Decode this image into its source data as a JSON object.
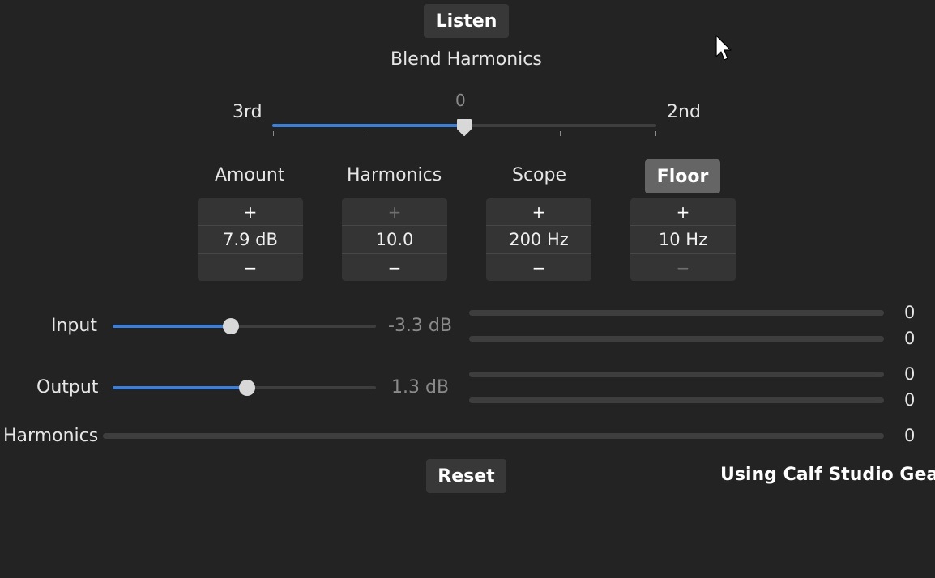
{
  "listen_button": "Listen",
  "blend": {
    "title": "Blend Harmonics",
    "left_label": "3rd",
    "right_label": "2nd",
    "value": "0",
    "position": 0.5
  },
  "spins": [
    {
      "label": "Amount",
      "value": "7.9 dB",
      "plus": "+",
      "minus": "−",
      "plus_enabled": true,
      "minus_enabled": true
    },
    {
      "label": "Harmonics",
      "value": "10.0",
      "plus": "+",
      "minus": "−",
      "plus_enabled": false,
      "minus_enabled": true
    },
    {
      "label": "Scope",
      "value": "200 Hz",
      "plus": "+",
      "minus": "−",
      "plus_enabled": true,
      "minus_enabled": true
    },
    {
      "label": "Floor",
      "value": "10 Hz",
      "plus": "+",
      "minus": "−",
      "plus_enabled": true,
      "minus_enabled": false
    }
  ],
  "input": {
    "label": "Input",
    "value": "-3.3 dB",
    "level": 0.45
  },
  "output": {
    "label": "Output",
    "value": "1.3 dB",
    "level": 0.51
  },
  "meters": {
    "input_left": "0",
    "input_right": "0",
    "output_left": "0",
    "output_right": "0",
    "harmonics": "0"
  },
  "harmonics_label": "Harmonics",
  "reset_button": "Reset",
  "footer": "Using Calf Studio Gear",
  "colors": {
    "accent": "#3d7fd6",
    "background": "#232323"
  }
}
